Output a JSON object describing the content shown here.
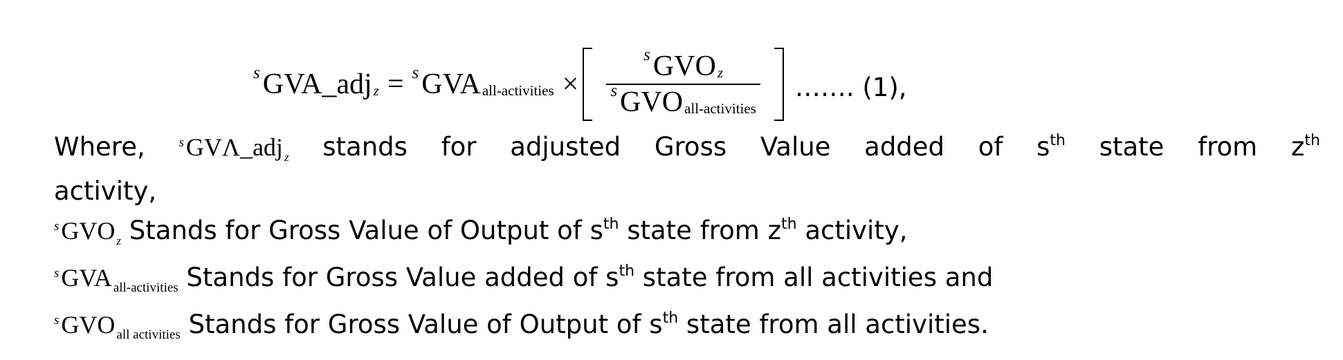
{
  "equation": {
    "lhs_superscript": "s",
    "lhs_symbol": "GVA_adj",
    "lhs_subscript": "z",
    "equals": "=",
    "rhs_superscript": "s",
    "rhs_symbol": "GVA",
    "rhs_subscript": "all-activities",
    "times": "×",
    "numerator_superscript": "s",
    "numerator_symbol": "GVO",
    "numerator_subscript": "z",
    "denominator_superscript": "s",
    "denominator_symbol": "GVO",
    "denominator_subscript": "all-activities",
    "number": "……. (1),"
  },
  "definitions": {
    "line1": {
      "w1": "Where,",
      "symbol_superscript": "s",
      "symbol": "GVΛ_adj",
      "symbol_subscript": "z",
      "w2": "stands",
      "w3": "for",
      "w4": "adjusted",
      "w5": "Gross",
      "w6": "Value",
      "w7": "added",
      "w8": "of",
      "w9": "s",
      "w9_sup": "th",
      "w10": "state",
      "w11": "from",
      "w12": "z",
      "w12_sup": "th"
    },
    "line2": {
      "text": "activity,"
    },
    "line3": {
      "symbol_superscript": "s",
      "symbol": "GVO",
      "symbol_subscript": "z",
      "text_a": " Stands for Gross Value of Output of s",
      "sup_a": "th",
      "text_b": " state from z",
      "sup_b": "th",
      "text_c": " activity,"
    },
    "line4": {
      "symbol_superscript": "s",
      "symbol": "GVA",
      "symbol_subscript": "all-activities",
      "text_a": " Stands for Gross Value added of s",
      "sup_a": "th",
      "text_b": " state from all activities and"
    },
    "line5": {
      "symbol_superscript": "s",
      "symbol": "GVO",
      "symbol_subscript": "all activities",
      "text_a": " Stands for Gross Value of Output of s",
      "sup_a": "th",
      "text_b": " state from all activities."
    }
  }
}
